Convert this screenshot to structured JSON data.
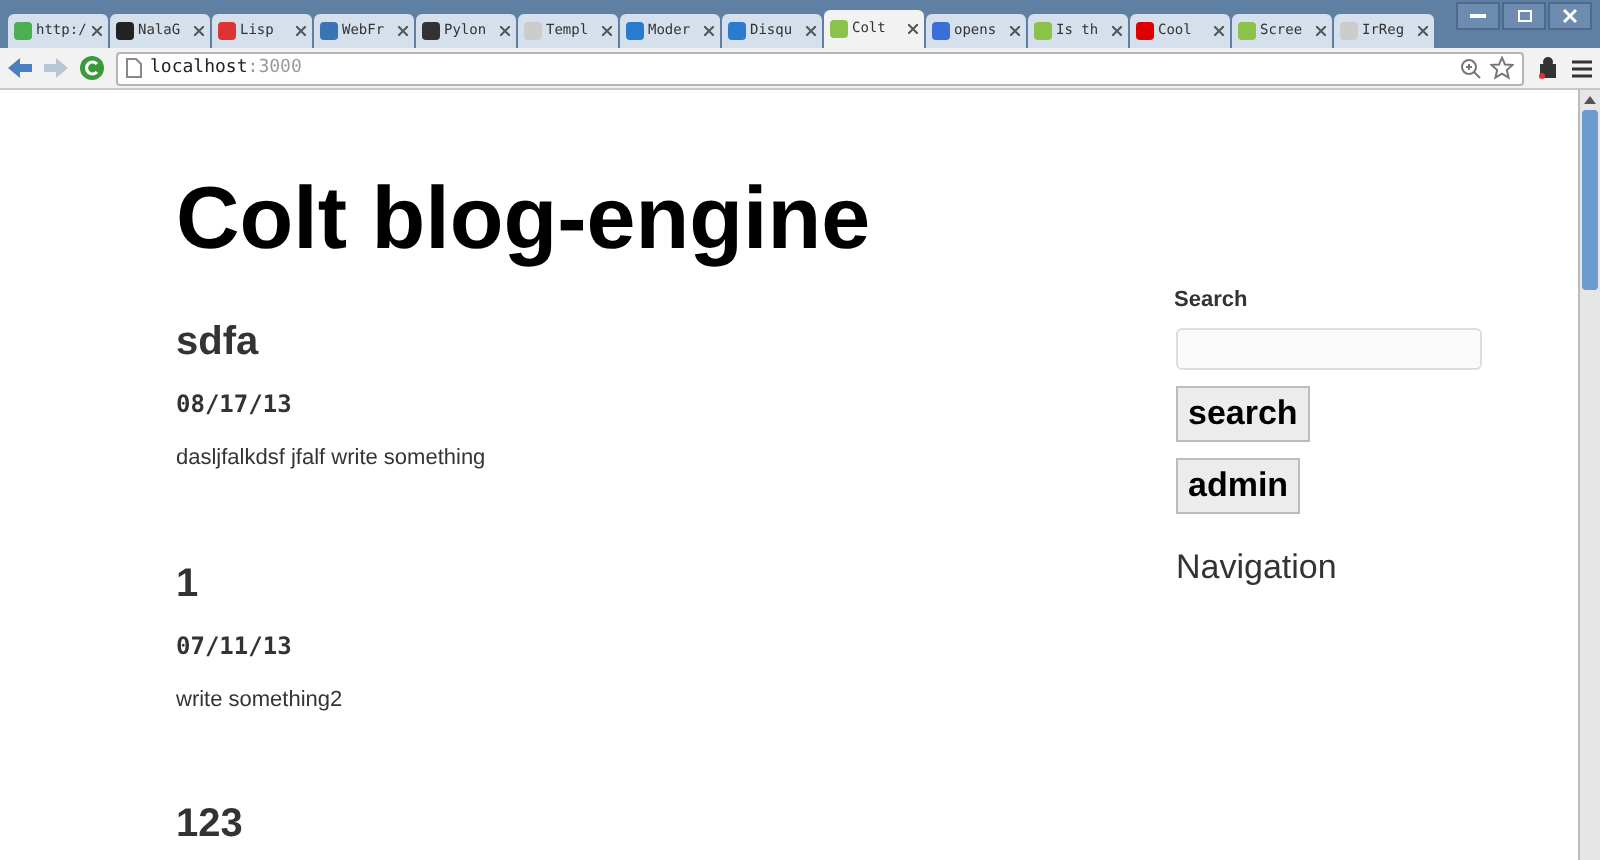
{
  "tabs": [
    {
      "title": "http:/",
      "selected": false
    },
    {
      "title": "NalaG",
      "selected": false
    },
    {
      "title": "Lisp",
      "selected": false
    },
    {
      "title": "WebFr",
      "selected": false
    },
    {
      "title": "Pylon",
      "selected": false
    },
    {
      "title": "Templ",
      "selected": false
    },
    {
      "title": "Moder",
      "selected": false
    },
    {
      "title": "Disqu",
      "selected": false
    },
    {
      "title": "Colt",
      "selected": true
    },
    {
      "title": "opens",
      "selected": false
    },
    {
      "title": "Is th",
      "selected": false
    },
    {
      "title": "Cool",
      "selected": false
    },
    {
      "title": "Scree",
      "selected": false
    },
    {
      "title": "IrReg",
      "selected": false
    }
  ],
  "address_bar": {
    "host": "localhost",
    "port": ":3000"
  },
  "page": {
    "title": "Colt blog-engine",
    "posts": [
      {
        "title": "sdfa",
        "date": "08/17/13",
        "body": "dasljfalkdsf jfalf write something"
      },
      {
        "title": "1",
        "date": "07/11/13",
        "body": "write something2"
      },
      {
        "title": "123"
      }
    ],
    "sidebar": {
      "search_label": "Search",
      "search_button": "search",
      "admin_button": "admin",
      "navigation_heading": "Navigation"
    }
  }
}
